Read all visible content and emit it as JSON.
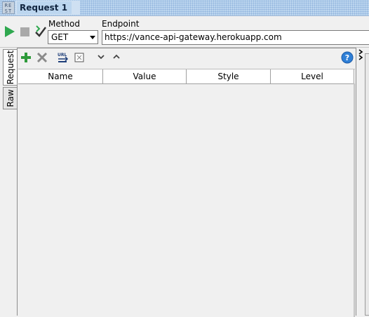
{
  "window": {
    "icon_text": "RE\nST",
    "title": "Request 1"
  },
  "request_bar": {
    "method_label": "Method",
    "method_value": "GET",
    "endpoint_label": "Endpoint",
    "endpoint_value": "https://vance-api-gateway.herokuapp.com"
  },
  "side_tabs": [
    {
      "label": "Request",
      "active": true
    },
    {
      "label": "Raw",
      "active": false
    }
  ],
  "params_table": {
    "columns": [
      "Name",
      "Value",
      "Style",
      "Level"
    ],
    "rows": []
  },
  "icons": {
    "run": "play-icon",
    "stop": "stop-icon",
    "validate": "check-icon",
    "add": "plus-icon",
    "remove": "x-icon",
    "url_params": "url-icon",
    "sort": "sort-icon",
    "move_down": "chevron-down-icon",
    "move_up": "chevron-up-icon",
    "help": "help-icon",
    "expand": "double-chevron-icon"
  },
  "colors": {
    "run_green": "#2fa84f",
    "add_green": "#2e9a3a",
    "help_blue": "#2f7fd6",
    "title_bg": "#bcd6ef"
  }
}
